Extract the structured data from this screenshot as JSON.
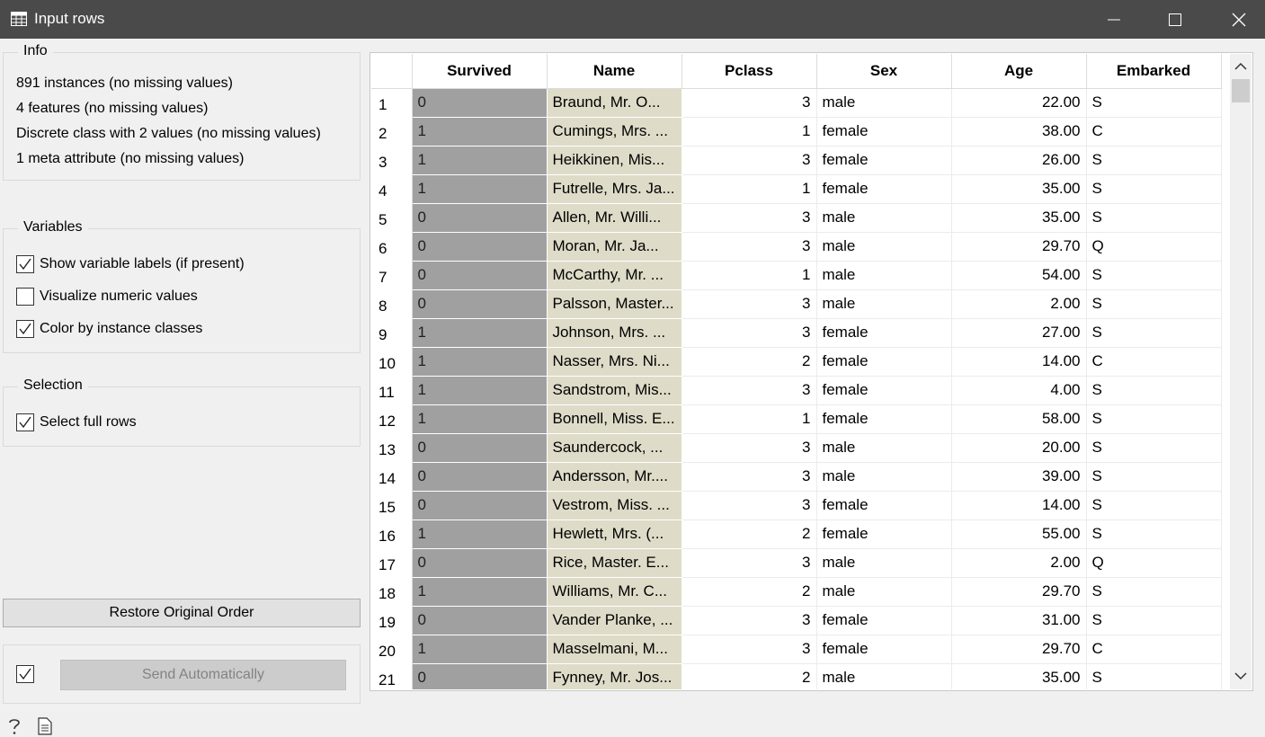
{
  "window": {
    "title": "Input rows"
  },
  "info": {
    "title": "Info",
    "lines": [
      "891 instances (no missing values)",
      "4 features (no missing values)",
      "Discrete class with 2 values (no missing values)",
      "1 meta attribute (no missing values)"
    ]
  },
  "variables": {
    "title": "Variables",
    "options": [
      {
        "label": "Show variable labels (if present)",
        "checked": true
      },
      {
        "label": "Visualize numeric values",
        "checked": false
      },
      {
        "label": "Color by instance classes",
        "checked": true
      }
    ]
  },
  "selection": {
    "title": "Selection",
    "options": [
      {
        "label": "Select full rows",
        "checked": true
      }
    ]
  },
  "buttons": {
    "restore": "Restore Original Order",
    "send": "Send Automatically",
    "send_auto_checked": true
  },
  "footer_icons": [
    "help-icon",
    "report-icon"
  ],
  "colors": {
    "titlebar": "#4a4a4a",
    "class_cell": "#a0a0a0",
    "meta_cell": "#dedbc8"
  },
  "table": {
    "columns": [
      "Survived",
      "Name",
      "Pclass",
      "Sex",
      "Age",
      "Embarked"
    ],
    "rows": [
      [
        "1",
        "0",
        "Braund, Mr. O...",
        "3",
        "male",
        "22.00",
        "S"
      ],
      [
        "2",
        "1",
        "Cumings, Mrs. ...",
        "1",
        "female",
        "38.00",
        "C"
      ],
      [
        "3",
        "1",
        "Heikkinen, Mis...",
        "3",
        "female",
        "26.00",
        "S"
      ],
      [
        "4",
        "1",
        "Futrelle, Mrs. Ja...",
        "1",
        "female",
        "35.00",
        "S"
      ],
      [
        "5",
        "0",
        "Allen, Mr. Willi...",
        "3",
        "male",
        "35.00",
        "S"
      ],
      [
        "6",
        "0",
        "Moran, Mr. Ja...",
        "3",
        "male",
        "29.70",
        "Q"
      ],
      [
        "7",
        "0",
        "McCarthy, Mr. ...",
        "1",
        "male",
        "54.00",
        "S"
      ],
      [
        "8",
        "0",
        "Palsson, Master...",
        "3",
        "male",
        "2.00",
        "S"
      ],
      [
        "9",
        "1",
        "Johnson, Mrs. ...",
        "3",
        "female",
        "27.00",
        "S"
      ],
      [
        "10",
        "1",
        "Nasser, Mrs. Ni...",
        "2",
        "female",
        "14.00",
        "C"
      ],
      [
        "11",
        "1",
        "Sandstrom, Mis...",
        "3",
        "female",
        "4.00",
        "S"
      ],
      [
        "12",
        "1",
        "Bonnell, Miss. E...",
        "1",
        "female",
        "58.00",
        "S"
      ],
      [
        "13",
        "0",
        "Saundercock, ...",
        "3",
        "male",
        "20.00",
        "S"
      ],
      [
        "14",
        "0",
        "Andersson, Mr....",
        "3",
        "male",
        "39.00",
        "S"
      ],
      [
        "15",
        "0",
        "Vestrom, Miss. ...",
        "3",
        "female",
        "14.00",
        "S"
      ],
      [
        "16",
        "1",
        "Hewlett, Mrs. (...",
        "2",
        "female",
        "55.00",
        "S"
      ],
      [
        "17",
        "0",
        "Rice, Master. E...",
        "3",
        "male",
        "2.00",
        "Q"
      ],
      [
        "18",
        "1",
        "Williams, Mr. C...",
        "2",
        "male",
        "29.70",
        "S"
      ],
      [
        "19",
        "0",
        "Vander Planke, ...",
        "3",
        "female",
        "31.00",
        "S"
      ],
      [
        "20",
        "1",
        "Masselmani, M...",
        "3",
        "female",
        "29.70",
        "C"
      ],
      [
        "21",
        "0",
        "Fynney, Mr. Jos...",
        "2",
        "male",
        "35.00",
        "S"
      ]
    ]
  }
}
